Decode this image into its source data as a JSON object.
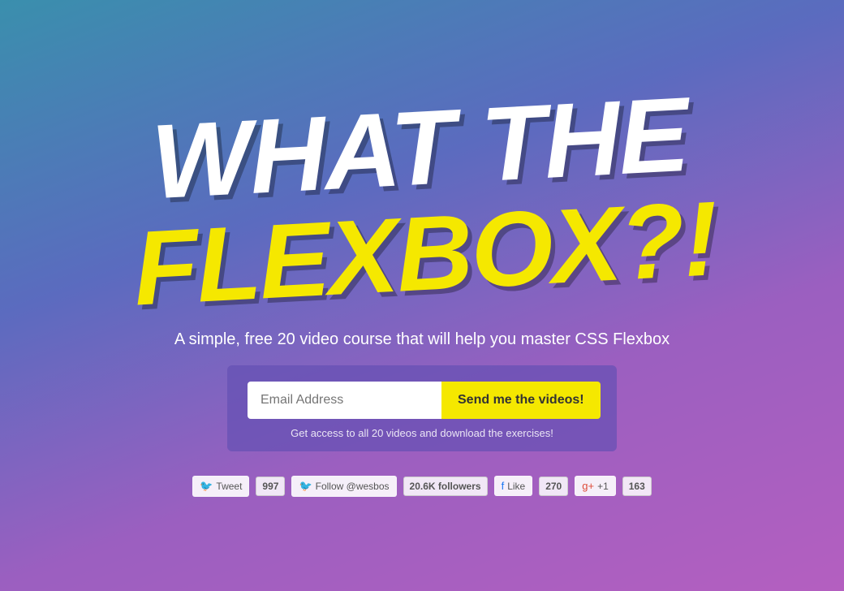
{
  "hero": {
    "line1": "WHAT THE",
    "line2": "FLEXBOX?!",
    "subtitle": "A simple, free 20 video course that will help you master CSS Flexbox"
  },
  "signup": {
    "email_placeholder": "Email Address",
    "submit_label": "Send me the videos!",
    "access_text": "Get access to all 20 videos and download the exercises!"
  },
  "social": {
    "tweet_label": "Tweet",
    "tweet_count": "997",
    "follow_label": "Follow @wesbos",
    "follow_count": "20.6K followers",
    "like_label": "Like",
    "like_count": "270",
    "gplus_label": "+1",
    "gplus_count": "163"
  }
}
